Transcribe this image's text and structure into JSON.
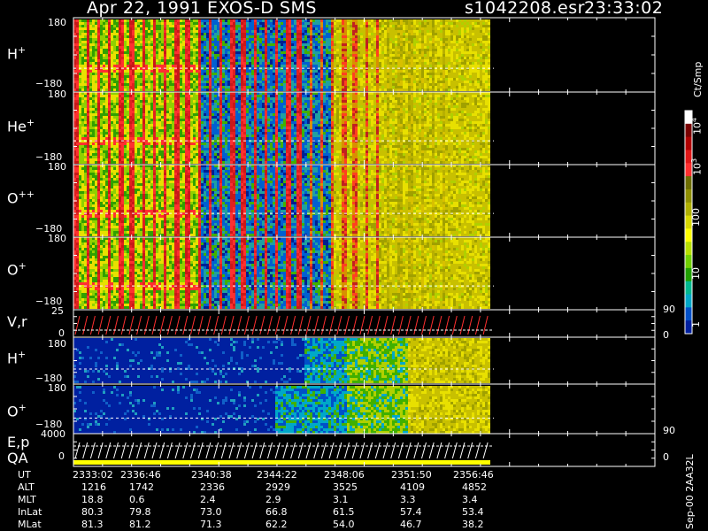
{
  "header": {
    "title": "Apr 22, 1991     EXOS-D SMS",
    "file": "s1042208.esr",
    "time": "23:33:02"
  },
  "colorbar": {
    "unit": "Ct/Smp",
    "ticks": [
      "10",
      "10",
      "100",
      "10",
      "1"
    ],
    "exponents": [
      "4",
      "3",
      "",
      "",
      ""
    ],
    "colors": [
      "#ffffff",
      "#7a0000",
      "#b00000",
      "#e01818",
      "#ff3030",
      "#6e6e00",
      "#8f8f00",
      "#b0b000",
      "#d8d800",
      "#ffff00",
      "#b8e000",
      "#70d000",
      "#20a000",
      "#00b890",
      "#00a8c8",
      "#0050c8",
      "#0020a0"
    ]
  },
  "panels": [
    {
      "name": "H",
      "sup": "+",
      "top": "180",
      "bot": "−180"
    },
    {
      "name": "He",
      "sup": "+",
      "top": "180",
      "bot": "−180"
    },
    {
      "name": "O",
      "sup": "++",
      "top": "180",
      "bot": "−180"
    },
    {
      "name": "O",
      "sup": "+",
      "top": "180",
      "bot": "−180"
    },
    {
      "name": "V,r",
      "sup": "",
      "top": "25",
      "bot": "0",
      "rtop": "90",
      "rbot": "0"
    },
    {
      "name": "H",
      "sup": "+",
      "top": "180",
      "bot": "−180"
    },
    {
      "name": "O",
      "sup": "+",
      "top": "180",
      "bot": "−180",
      "rtop": "90"
    },
    {
      "name": "E,p",
      "sup": "",
      "top": "4000",
      "bot": "0",
      "rbot": "0"
    },
    {
      "name": "QA",
      "sup": ""
    }
  ],
  "footer": {
    "side_label": "Sep-00  2AA32L",
    "rows": [
      {
        "label": "UT",
        "values": [
          "2333:02",
          "2336:46",
          "2340:38",
          "2344:22",
          "2348:06",
          "2351:50",
          "2356:46"
        ]
      },
      {
        "label": "ALT",
        "values": [
          "1216",
          "1742",
          "2336",
          "2929",
          "3525",
          "4109",
          "4852"
        ]
      },
      {
        "label": "MLT",
        "values": [
          "18.8",
          "0.6",
          "2.4",
          "2.9",
          "3.1",
          "3.3",
          "3.4"
        ]
      },
      {
        "label": "InLat",
        "values": [
          "80.3",
          "79.8",
          "73.0",
          "66.8",
          "61.5",
          "57.4",
          "53.4"
        ]
      },
      {
        "label": "MLat",
        "values": [
          "81.3",
          "81.2",
          "71.3",
          "62.2",
          "54.0",
          "46.7",
          "38.2"
        ]
      }
    ]
  },
  "chart_data": {
    "type": "heatmap",
    "title": "Apr 22, 1991     EXOS-D SMS",
    "x_ticks_ut": [
      "2333:02",
      "2336:46",
      "2340:38",
      "2344:22",
      "2348:06",
      "2351:50",
      "2356:46"
    ],
    "colorbar_range": [
      1,
      10000
    ],
    "colorbar_unit": "Ct/Smp",
    "panels": [
      "H+",
      "He+",
      "O++",
      "O+",
      "V,r",
      "H+",
      "O+",
      "E,p",
      "QA"
    ],
    "y_range_pitch_deg": [
      -180,
      180
    ]
  }
}
